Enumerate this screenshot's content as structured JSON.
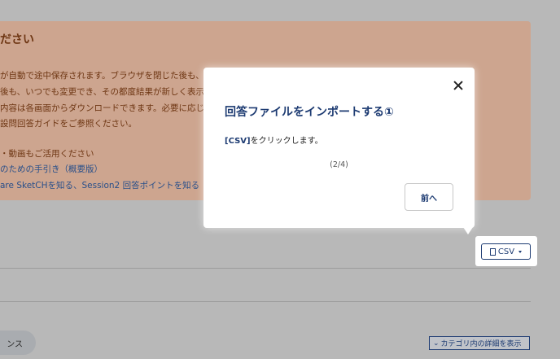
{
  "notice": {
    "title": "ださい",
    "lines": [
      "が自動で途中保存されます。ブラウザを閉じた後も、",
      "後も、いつでも変更でき、その都度結果が新しく表示",
      "内容は各画面からダウンロードできます。必要に応じ",
      "設問回答ガイドをご参照ください。",
      "・動画もご活用ください"
    ],
    "links": [
      "のための手引き（概要版）",
      "are SketCHを知る、Session2 回答ポイントを知る"
    ]
  },
  "bottom": {
    "pill_label": "ンス",
    "detail_button": "カテゴリ内の詳細を表示"
  },
  "csv_button": {
    "label": "CSV"
  },
  "popover": {
    "title": "回答ファイルをインポートする①",
    "body_bold": "[CSV]",
    "body_rest": "をクリックします。",
    "step": "(2/4)",
    "prev_button": "前へ"
  }
}
